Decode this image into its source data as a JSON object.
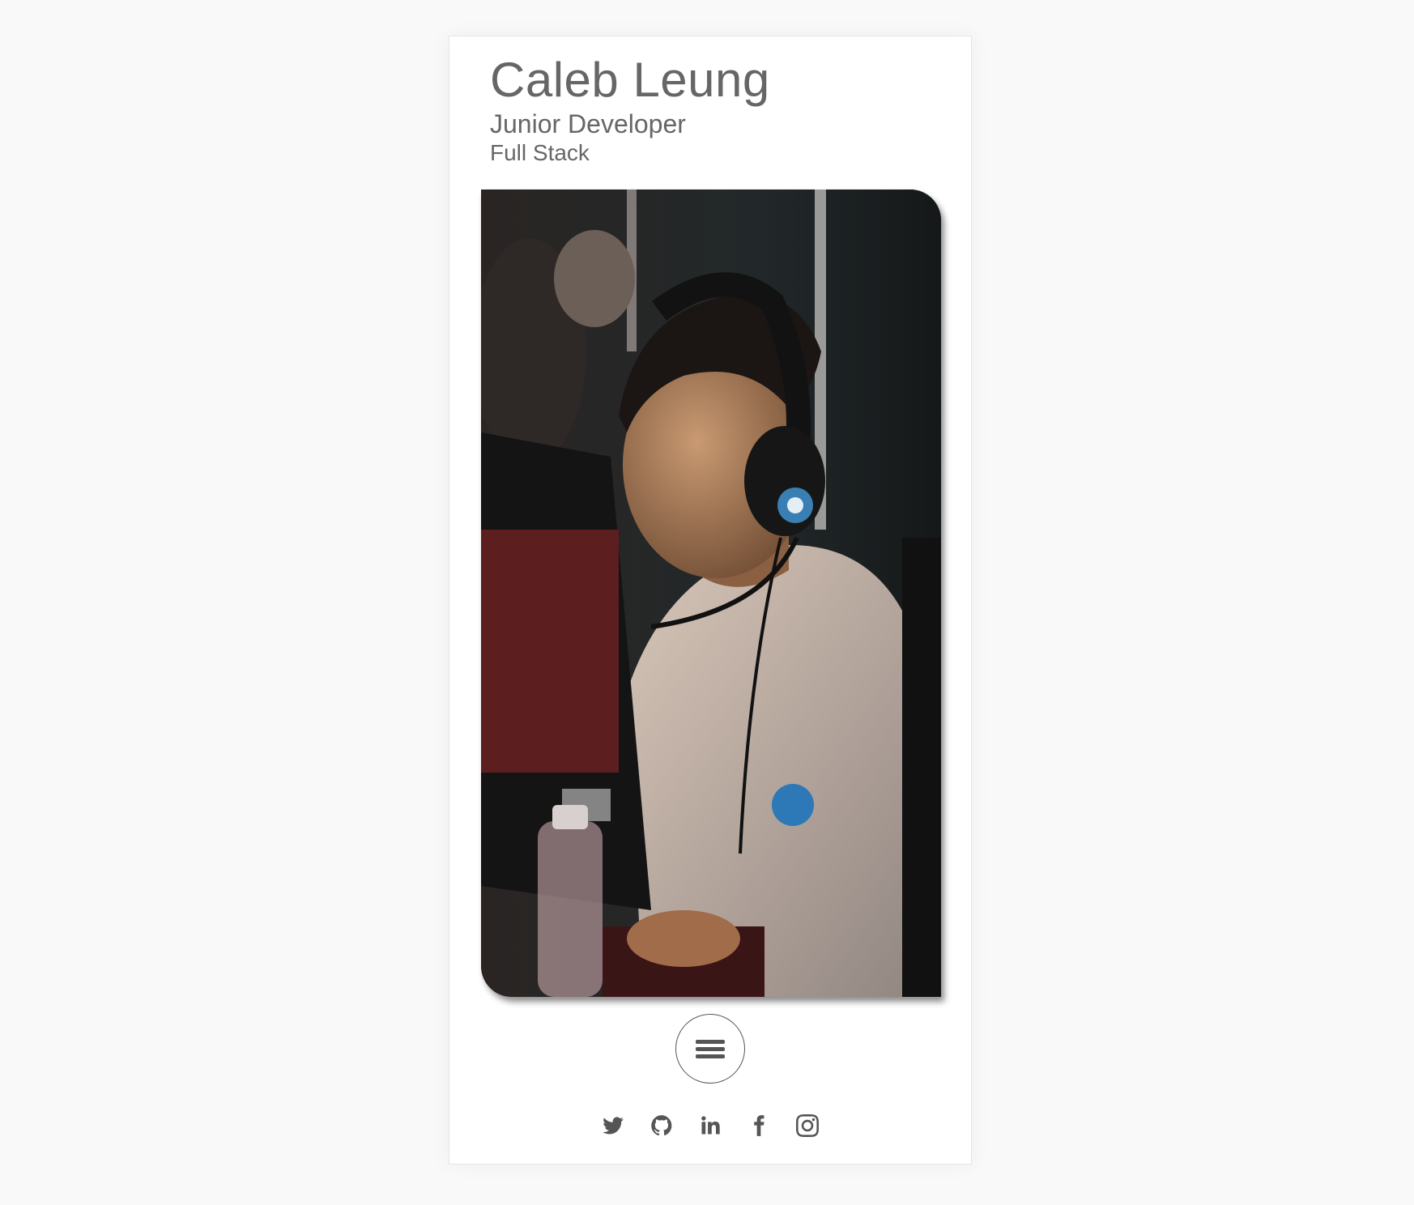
{
  "profile": {
    "name": "Caleb Leung",
    "title": "Junior Developer",
    "subtitle": "Full Stack"
  },
  "photo": {
    "alt": "Person wearing headphones at a computer"
  },
  "menu": {
    "icon": "hamburger-menu-icon"
  },
  "social": [
    {
      "name": "twitter",
      "icon": "twitter-icon"
    },
    {
      "name": "github",
      "icon": "github-icon"
    },
    {
      "name": "linkedin",
      "icon": "linkedin-icon"
    },
    {
      "name": "facebook",
      "icon": "facebook-icon"
    },
    {
      "name": "instagram",
      "icon": "instagram-icon"
    }
  ],
  "colors": {
    "text": "#666666",
    "icon": "#555555",
    "background": "#f9f9f9",
    "card": "#ffffff"
  }
}
